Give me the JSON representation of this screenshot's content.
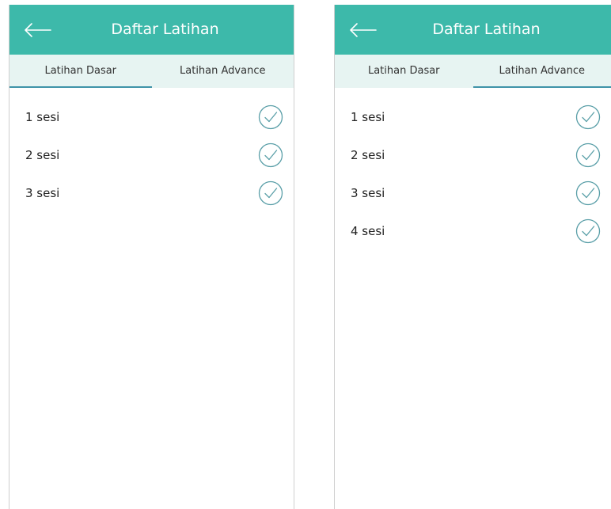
{
  "screens": [
    {
      "title": "Daftar Latihan",
      "tabs": [
        {
          "label": "Latihan Dasar",
          "active": true
        },
        {
          "label": "Latihan Advance",
          "active": false
        }
      ],
      "items": [
        {
          "label": "1 sesi"
        },
        {
          "label": "2 sesi"
        },
        {
          "label": "3 sesi"
        }
      ]
    },
    {
      "title": "Daftar Latihan",
      "tabs": [
        {
          "label": "Latihan Dasar",
          "active": false
        },
        {
          "label": "Latihan Advance",
          "active": true
        }
      ],
      "items": [
        {
          "label": "1 sesi"
        },
        {
          "label": "2 sesi"
        },
        {
          "label": "3 sesi"
        },
        {
          "label": "4 sesi"
        }
      ]
    }
  ],
  "icons": {
    "back": "arrow-left-icon",
    "check": "check-circle-icon"
  },
  "colors": {
    "appbar": "#3db9aa",
    "tab_bg": "#e7f4f2",
    "tab_indicator": "#3f93a8",
    "check": "#5a9fa8"
  }
}
